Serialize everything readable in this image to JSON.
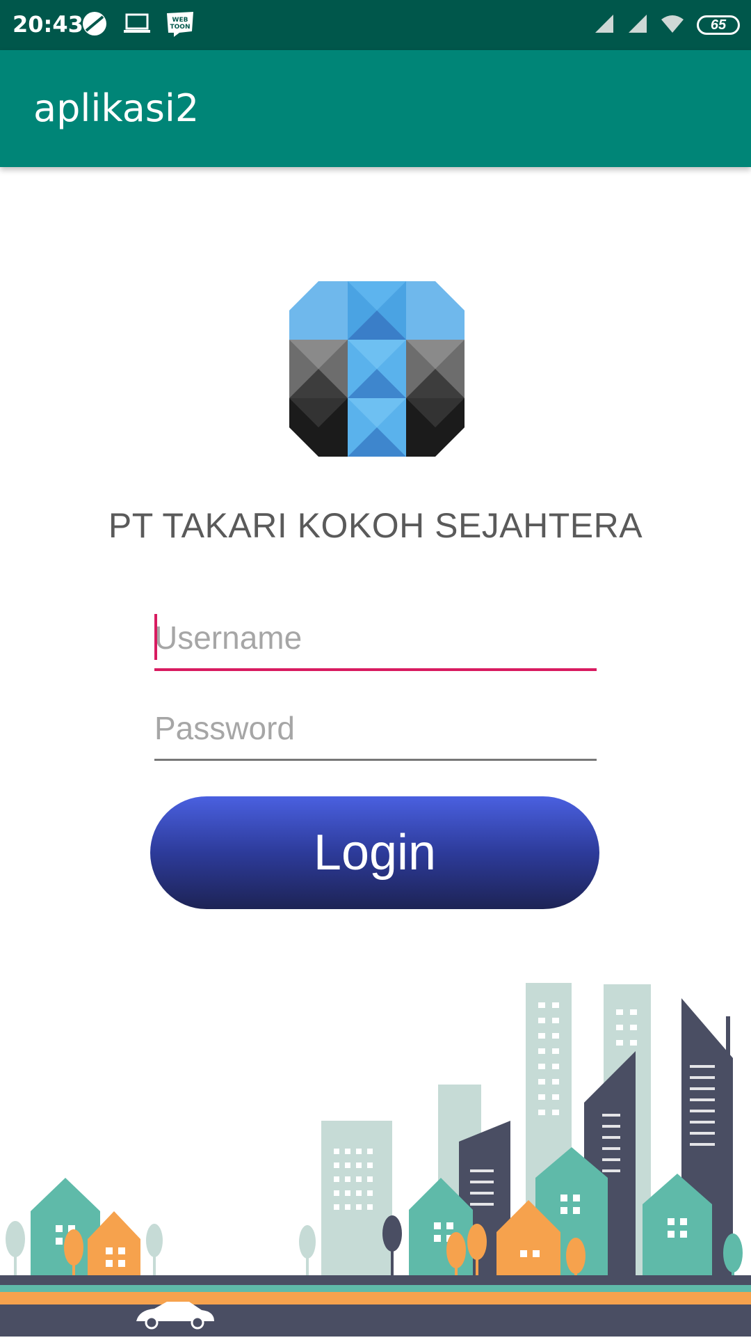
{
  "status_bar": {
    "time": "20:43",
    "battery": "65",
    "icons": [
      "browser-icon",
      "laptop-icon",
      "webtoon-icon",
      "signal-icon",
      "signal-icon",
      "wifi-icon",
      "battery-icon"
    ]
  },
  "app_bar": {
    "title": "aplikasi2"
  },
  "logo": {
    "icon": "company-logo"
  },
  "company_name": "PT TAKARI KOKOH SEJAHTERA",
  "form": {
    "username_placeholder": "Username",
    "username_value": "",
    "password_placeholder": "Password",
    "password_value": "",
    "login_label": "Login"
  },
  "colors": {
    "status_bar": "#00574b",
    "app_bar": "#008577",
    "accent": "#d81b60",
    "button_top": "#4a60e0",
    "button_bottom": "#1d2355"
  },
  "illustration": {
    "icon": "city-skyline-illustration"
  }
}
